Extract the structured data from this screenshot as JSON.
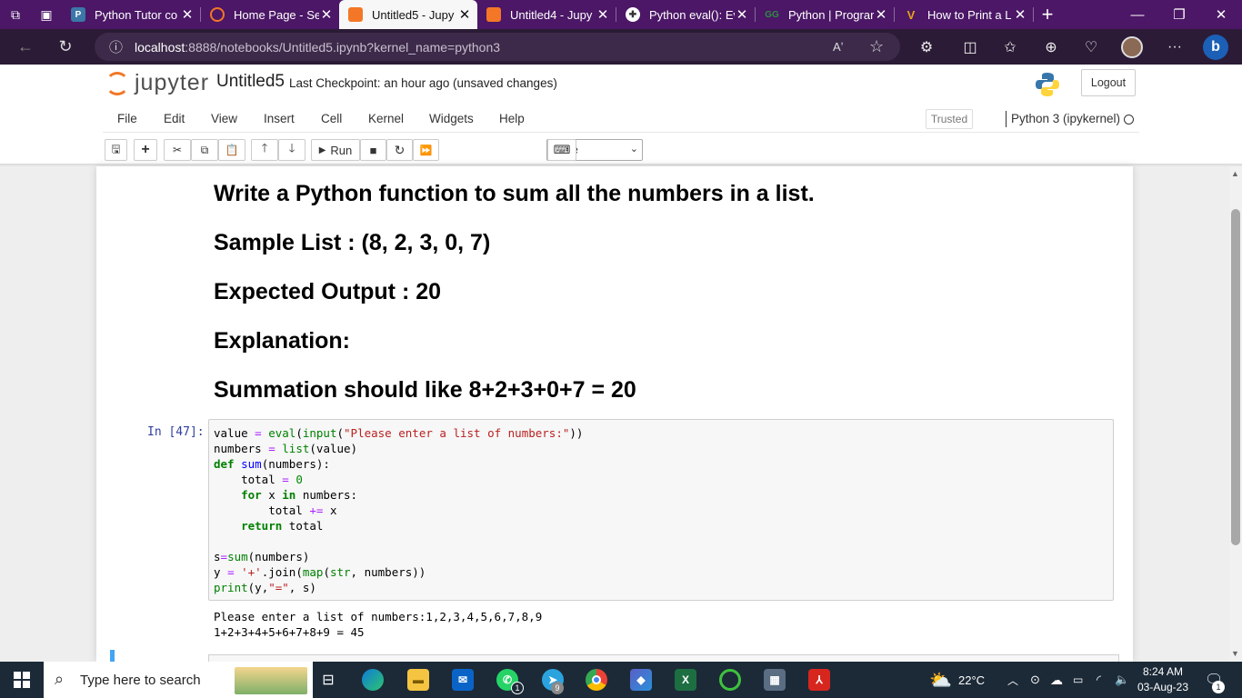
{
  "browser": {
    "tabs": [
      {
        "title": "Python Tutor co",
        "fav_color": "#3b77a8",
        "fav_text": "P",
        "active": false
      },
      {
        "title": "Home Page - Se",
        "fav_color": "#f37726",
        "fav_text": "",
        "active": false
      },
      {
        "title": "Untitled5 - Jupy",
        "fav_color": "#f37726",
        "fav_text": "",
        "active": true
      },
      {
        "title": "Untitled4 - Jupy",
        "fav_color": "#f37726",
        "fav_text": "",
        "active": false
      },
      {
        "title": "Python eval(): Ev",
        "fav_color": "#ffffff",
        "fav_text": "",
        "active": false
      },
      {
        "title": "Python | Prograr",
        "fav_color": "#2f8d46",
        "fav_text": "GG",
        "active": false
      },
      {
        "title": "How to Print a L",
        "fav_color": "#e8a317",
        "fav_text": "V",
        "active": false
      }
    ],
    "url_host": "localhost",
    "url_path": ":8888/notebooks/Untitled5.ipynb?kernel_name=python3"
  },
  "jupyter": {
    "logo_text": "jupyter",
    "notebook_name": "Untitled5",
    "checkpoint": "Last Checkpoint: an hour ago",
    "unsaved": "(unsaved changes)",
    "logout": "Logout",
    "menus": [
      "File",
      "Edit",
      "View",
      "Insert",
      "Cell",
      "Kernel",
      "Widgets",
      "Help"
    ],
    "trusted": "Trusted",
    "kernel": "Python 3 (ipykernel)",
    "run_label": "Run",
    "cell_type": "Code"
  },
  "notebook": {
    "markdown": [
      "Write a Python function to sum all the numbers in a list.",
      "Sample List : (8, 2, 3, 0, 7)",
      "Expected Output : 20",
      "Explanation:",
      "Summation should like 8+2+3+0+7 = 20"
    ],
    "prompt": "In [47]:",
    "output": "Please enter a list of numbers:1,2,3,4,5,6,7,8,9\n1+2+3+4+5+6+7+8+9 = 45"
  },
  "taskbar": {
    "search_placeholder": "Type here to search",
    "temperature": "22°C",
    "time": "8:24 AM",
    "date": "03-Aug-23",
    "notification_count": "1",
    "whatsapp_badge": "1",
    "telegram_badge": "9"
  }
}
